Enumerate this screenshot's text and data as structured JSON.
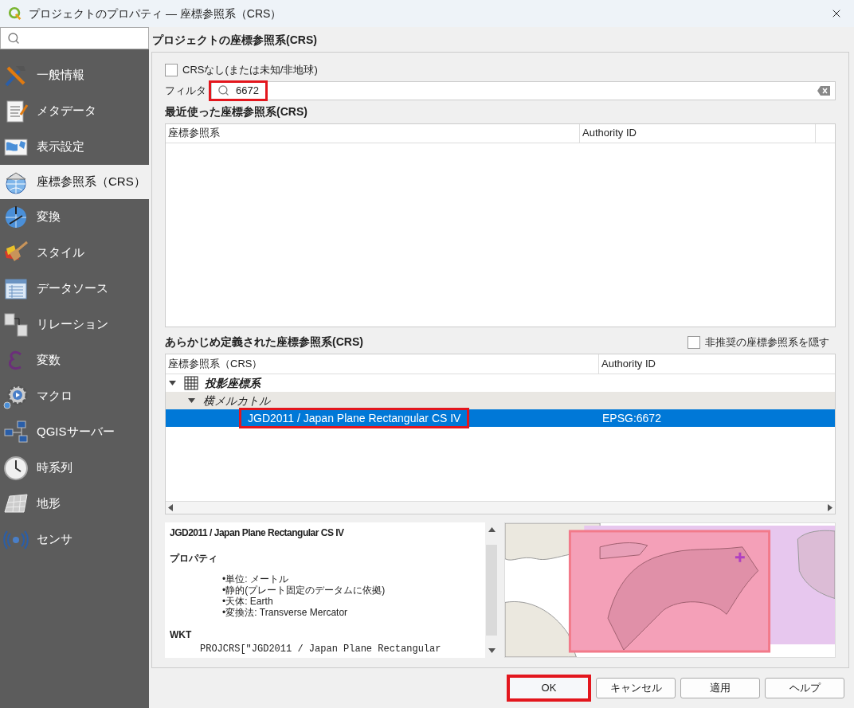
{
  "window": {
    "title": "プロジェクトのプロパティ — 座標参照系（CRS）"
  },
  "sidebar": {
    "items": [
      {
        "label": "一般情報",
        "selected": false
      },
      {
        "label": "メタデータ",
        "selected": false
      },
      {
        "label": "表示設定",
        "selected": false
      },
      {
        "label": "座標参照系（CRS）",
        "selected": true
      },
      {
        "label": "変換",
        "selected": false
      },
      {
        "label": "スタイル",
        "selected": false
      },
      {
        "label": "データソース",
        "selected": false
      },
      {
        "label": "リレーション",
        "selected": false
      },
      {
        "label": "変数",
        "selected": false
      },
      {
        "label": "マクロ",
        "selected": false
      },
      {
        "label": "QGISサーバー",
        "selected": false
      },
      {
        "label": "時系列",
        "selected": false
      },
      {
        "label": "地形",
        "selected": false
      },
      {
        "label": "センサ",
        "selected": false
      }
    ]
  },
  "crs_panel": {
    "title": "プロジェクトの座標参照系(CRS)",
    "no_crs": {
      "label": "CRSなし(または未知/非地球)",
      "checked": false
    },
    "filter": {
      "label": "フィルタ",
      "value": "6672",
      "highlighted": true
    },
    "recent": {
      "title": "最近使った座標参照系(CRS)",
      "columns": [
        "座標参照系",
        "Authority ID"
      ]
    },
    "predefined": {
      "title": "あらかじめ定義された座標参照系(CRS)",
      "hide_deprecated": {
        "label": "非推奨の座標参照系を隠す",
        "checked": false
      },
      "columns": [
        "座標参照系（CRS）",
        "Authority ID"
      ],
      "tree": [
        {
          "label": "投影座標系",
          "expanded": true,
          "children": [
            {
              "label": "横メルカトル",
              "expanded": true,
              "children": [
                {
                  "label": "JGD2011 / Japan Plane Rectangular CS IV",
                  "authority_id": "EPSG:6672",
                  "selected": true,
                  "highlighted": true
                }
              ]
            }
          ]
        }
      ]
    },
    "details": {
      "name": "JGD2011 / Japan Plane Rectangular CS IV",
      "properties_title": "プロパティ",
      "properties": [
        "•単位: メートル",
        "•静的(プレート固定のデータムに依拠)",
        "•天体: Earth",
        "•変換法: Transverse Mercator"
      ],
      "wkt_title": "WKT",
      "wkt": "PROJCRS[\"JGD2011 / Japan Plane Rectangular"
    }
  },
  "buttons": [
    {
      "label": "OK",
      "highlighted": true
    },
    {
      "label": "キャンセル",
      "highlighted": false
    },
    {
      "label": "適用",
      "highlighted": false
    },
    {
      "label": "ヘルプ",
      "highlighted": false
    }
  ]
}
